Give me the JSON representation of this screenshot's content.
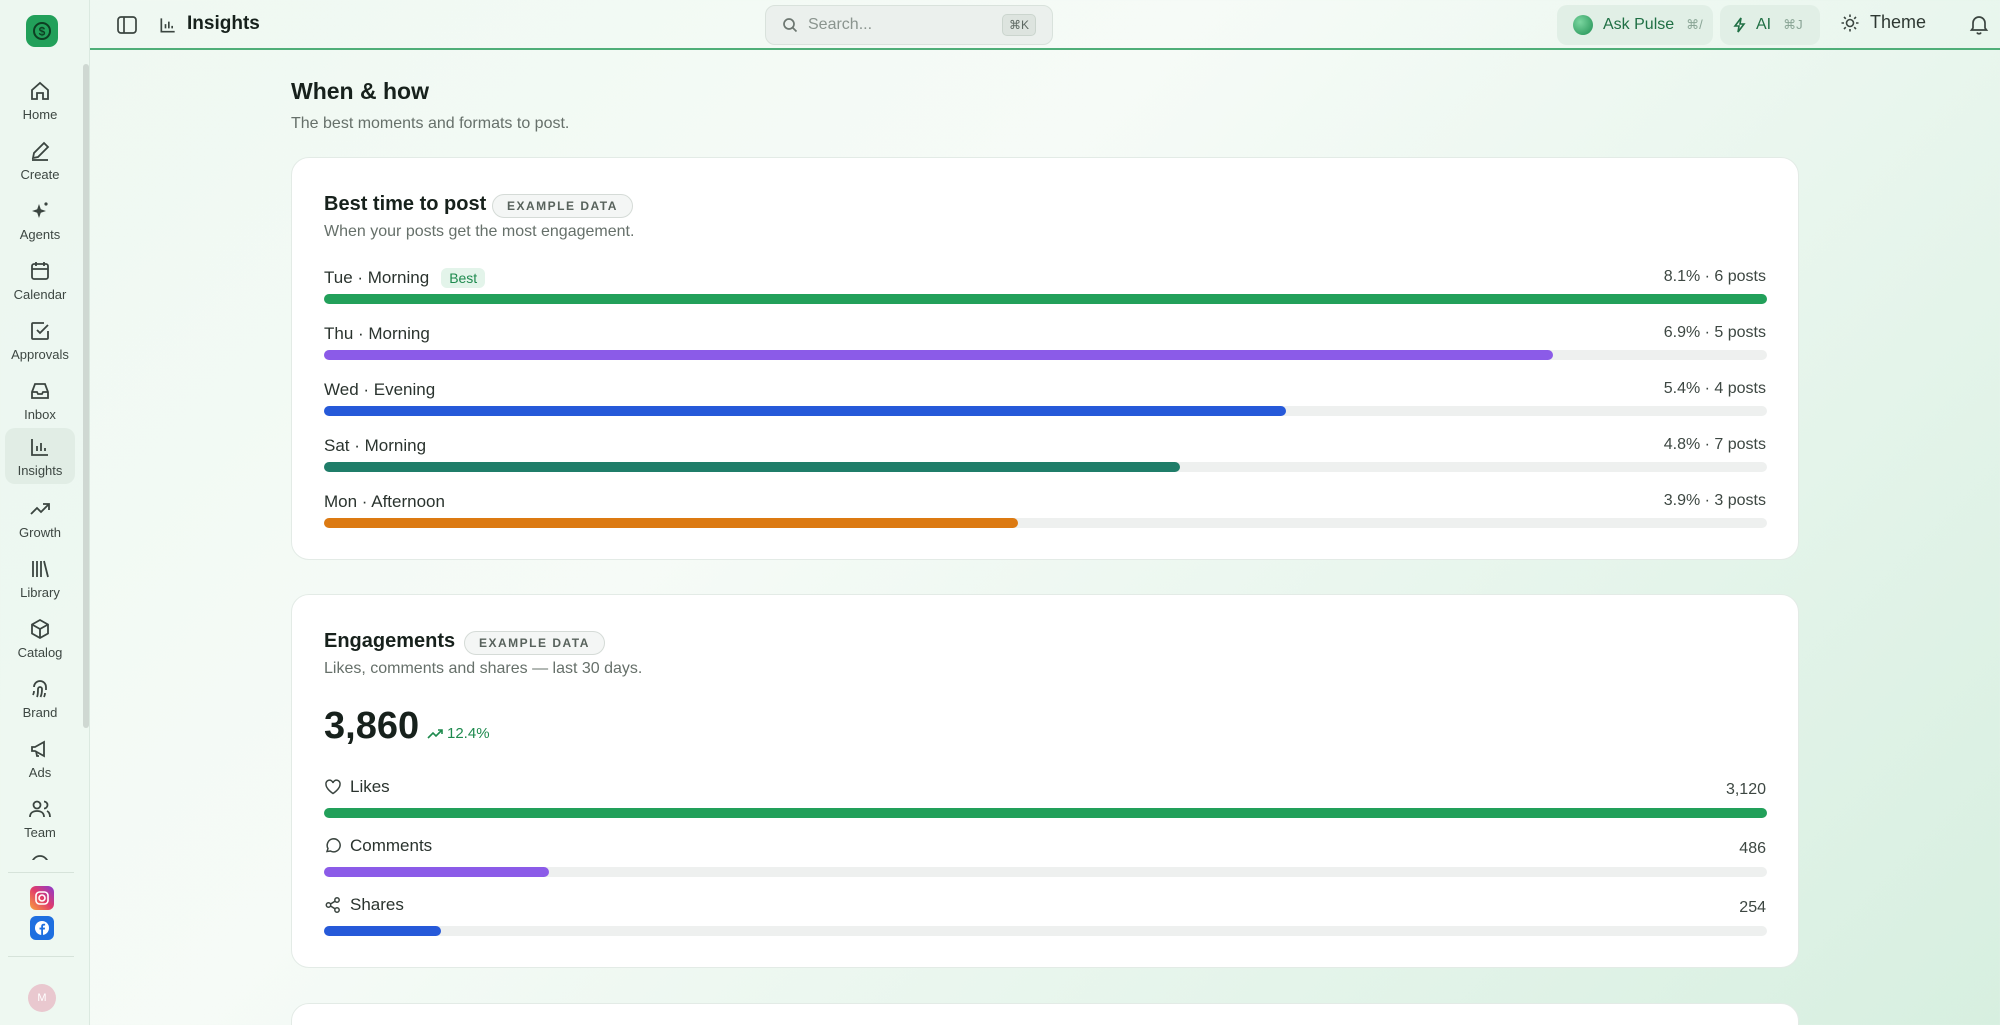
{
  "sidebar": {
    "items": [
      {
        "label": "Home",
        "icon": "home-icon"
      },
      {
        "label": "Create",
        "icon": "pencil-icon"
      },
      {
        "label": "Agents",
        "icon": "sparkle-icon"
      },
      {
        "label": "Calendar",
        "icon": "calendar-icon"
      },
      {
        "label": "Approvals",
        "icon": "checkbox-icon"
      },
      {
        "label": "Inbox",
        "icon": "inbox-icon"
      },
      {
        "label": "Insights",
        "icon": "bar-chart-icon",
        "active": true
      },
      {
        "label": "Growth",
        "icon": "trending-up-icon"
      },
      {
        "label": "Library",
        "icon": "library-icon"
      },
      {
        "label": "Catalog",
        "icon": "box-icon"
      },
      {
        "label": "Brand",
        "icon": "fingerprint-icon"
      },
      {
        "label": "Ads",
        "icon": "megaphone-icon"
      },
      {
        "label": "Team",
        "icon": "users-icon"
      }
    ],
    "avatar_initial": "M"
  },
  "topbar": {
    "title": "Insights",
    "search_placeholder": "Search...",
    "search_shortcut": "⌘K",
    "ask_pulse": "Ask Pulse",
    "ask_pulse_shortcut": "⌘/",
    "ai": "AI",
    "ai_shortcut": "⌘J",
    "theme": "Theme"
  },
  "section": {
    "title": "When & how",
    "subtitle": "The best moments and formats to post."
  },
  "best_time": {
    "title": "Best time to post",
    "badge": "EXAMPLE DATA",
    "subtitle": "When your posts get the most engagement.",
    "best_label": "Best",
    "rows": [
      {
        "label": "Tue · Morning",
        "value": "8.1% · 6 posts",
        "fraction": 1.0,
        "color": "#22a05a",
        "best": true
      },
      {
        "label": "Thu · Morning",
        "value": "6.9% · 5 posts",
        "fraction": 0.852,
        "color": "#8b5be8"
      },
      {
        "label": "Wed · Evening",
        "value": "5.4% · 4 posts",
        "fraction": 0.667,
        "color": "#2659d9"
      },
      {
        "label": "Sat · Morning",
        "value": "4.8% · 7 posts",
        "fraction": 0.593,
        "color": "#1f7d69"
      },
      {
        "label": "Mon · Afternoon",
        "value": "3.9% · 3 posts",
        "fraction": 0.481,
        "color": "#dc7a12"
      }
    ]
  },
  "engagements": {
    "title": "Engagements",
    "badge": "EXAMPLE DATA",
    "subtitle": "Likes, comments and shares — last 30 days.",
    "total": "3,860",
    "change": "12.4%",
    "rows": [
      {
        "label": "Likes",
        "value": "3,120",
        "fraction": 1.0,
        "color": "#22a05a",
        "icon": "heart-icon"
      },
      {
        "label": "Comments",
        "value": "486",
        "fraction": 0.156,
        "color": "#8b5be8",
        "icon": "comment-icon"
      },
      {
        "label": "Shares",
        "value": "254",
        "fraction": 0.081,
        "color": "#2659d9",
        "icon": "share-icon"
      }
    ]
  },
  "colors": {
    "accent": "#22a05a",
    "purple": "#8b5be8",
    "blue": "#2659d9",
    "teal": "#1f7d69",
    "orange": "#dc7a12"
  }
}
